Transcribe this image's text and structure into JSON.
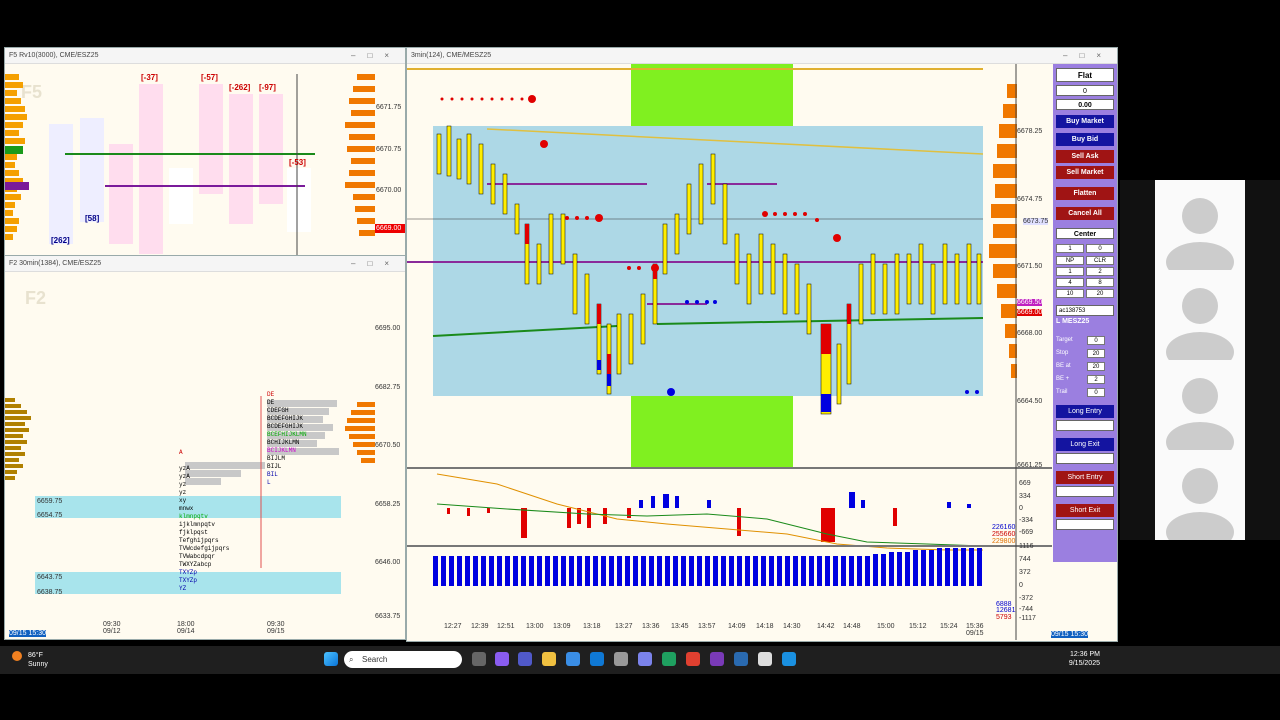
{
  "windows": {
    "f5": {
      "title": "F5 Rv10(3000), CME/ESZ25",
      "watermark": "F5",
      "prices": [
        "6671.75",
        "6670.75",
        "6670.00",
        "6669.00"
      ],
      "bracket_labels": [
        "[-37]",
        "[-57]",
        "[-262]",
        "[-97]",
        "[-53]",
        "[262]",
        "[58]"
      ]
    },
    "f2": {
      "title": "F2 30min(1384), CME/ESZ25",
      "watermark": "F2",
      "prices": [
        "6695.00",
        "6682.75",
        "6670.50",
        "6658.25",
        "6646.00",
        "6633.75"
      ],
      "levels": [
        "6659.75",
        "6654.75",
        "6643.75",
        "6638.75"
      ],
      "time_labels": [
        "09/15 15:30",
        "09:30\n09/12",
        "18:00\n09/14",
        "09:30\n09/15"
      ]
    },
    "main": {
      "title": "3min(124), CME/MESZ25",
      "prices": [
        "6678.25",
        "6674.75",
        "6671.50",
        "6668.00",
        "6664.50",
        "6661.25"
      ],
      "price_tags": [
        "6673.75",
        "6669.50",
        "6669.00"
      ],
      "osc_labels": [
        "669",
        "334",
        "0",
        "-334",
        "-669"
      ],
      "vol_labels": [
        "1116",
        "744",
        "372",
        "0",
        "-372",
        "-744",
        "-1117"
      ],
      "side_values": [
        "226160",
        "255660",
        "229800"
      ],
      "vol_values": [
        "6888",
        "12681",
        "5793"
      ],
      "time_labels": [
        "12:27",
        "12:39",
        "12:51",
        "13:00",
        "13:09",
        "13:18",
        "13:27",
        "13:36",
        "13:45",
        "13:57",
        "14:09",
        "14:18",
        "14:30",
        "14:42",
        "14:48",
        "15:00",
        "15:12",
        "15:24",
        "15:36\n09/15"
      ],
      "corner_time": "09/15 15:30"
    }
  },
  "order_panel": {
    "position_label": "Flat",
    "qty": "0",
    "pnl": "0.00",
    "buy_market": "Buy Market",
    "buy_bid": "Buy Bid",
    "sell_ask": "Sell Ask",
    "sell_market": "Sell Market",
    "flatten": "Flatten",
    "cancel_all": "Cancel All",
    "center": "Center",
    "qty_input": "1",
    "qty_right": "0",
    "np": "NP",
    "clr": "CLR",
    "grid": [
      "1",
      "2",
      "4",
      "8",
      "10",
      "20"
    ],
    "account": "ac138753",
    "symbol": "L MESZ25",
    "target_label": "Target",
    "target_val": "0",
    "stop_label": "Stop",
    "stop_val": "20",
    "be_at_label": "BE at",
    "be_at_val": "20",
    "be_plus_label": "BE +",
    "be_plus_val": "2",
    "trail_label": "Trail",
    "trail_val": "0",
    "long_entry": "Long Entry",
    "long_exit": "Long Exit",
    "short_entry": "Short Entry",
    "short_exit": "Short Exit",
    "colors": {
      "blue": "#1414a0",
      "red": "#a01414",
      "panel": "#9b7fe0"
    }
  },
  "taskbar": {
    "weather_temp": "86°F",
    "weather_desc": "Sunny",
    "search_placeholder": "Search",
    "time": "12:36 PM",
    "date": "9/15/2025"
  }
}
